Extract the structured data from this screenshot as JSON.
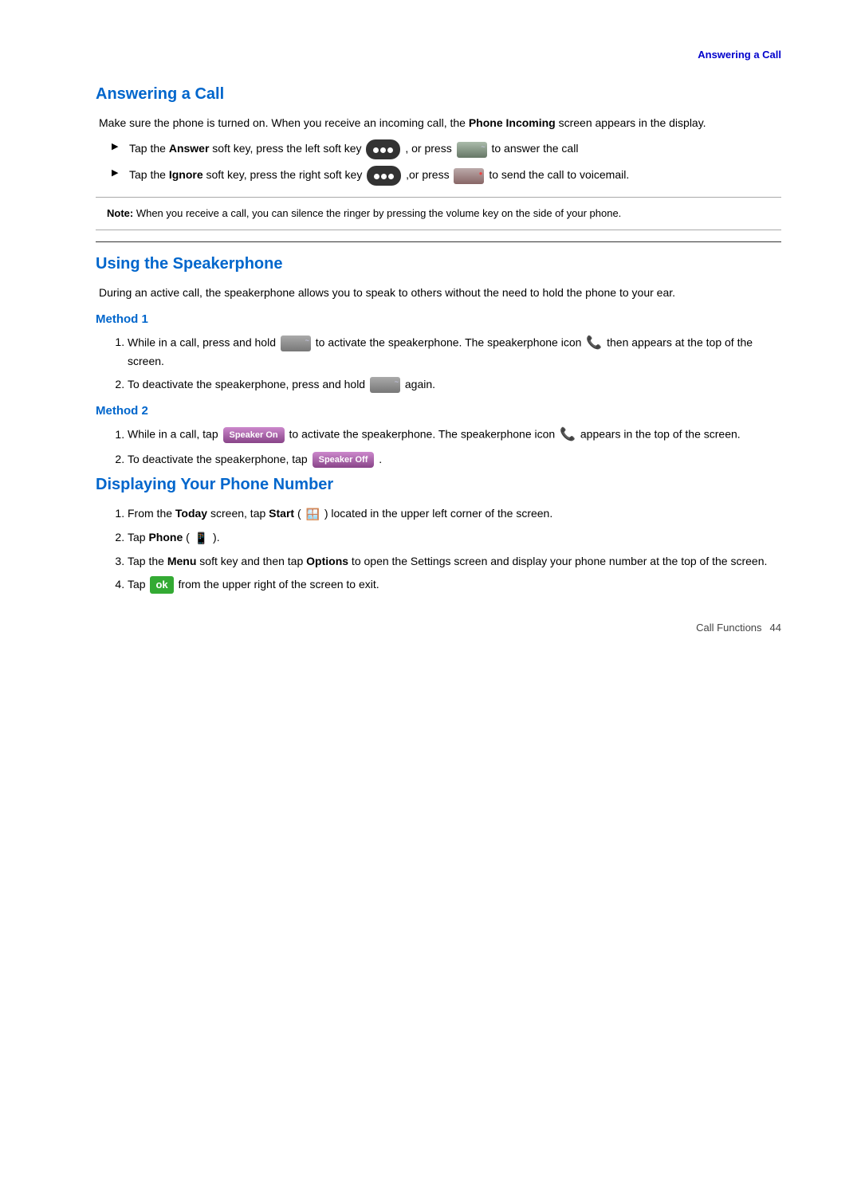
{
  "header": {
    "nav_label": "Answering a Call"
  },
  "section1": {
    "title": "Answering a Call",
    "intro": "Make sure the phone is turned on. When you receive an incoming call, the Phone Incoming screen appears in the display.",
    "bullets": [
      {
        "text_before": "Tap the ",
        "bold1": "Answer",
        "text_middle": " soft key, press the left soft key",
        "icon_oval": true,
        "text_after": ", or press",
        "key_type": "answer",
        "end_text": "to answer the call"
      },
      {
        "text_before": "Tap the ",
        "bold1": "Ignore",
        "text_middle": " soft key, press the right soft key",
        "icon_oval": true,
        "text_after": ",or press",
        "key_type": "ignore",
        "end_text": "to send the call to voicemail."
      }
    ],
    "note": "When you receive a call, you can silence the ringer by pressing the volume key on the side of your phone."
  },
  "section2": {
    "title": "Using the Speakerphone",
    "intro": "During an active call, the speakerphone allows you to speak to others without the need to hold the phone to your ear.",
    "method1": {
      "label": "Method 1",
      "steps": [
        "While in a call, press and hold [key] to activate the speakerphone. The speakerphone icon [icon] then appears at the top of the screen.",
        "To deactivate the speakerphone, press and hold [key] again."
      ]
    },
    "method2": {
      "label": "Method 2",
      "steps": [
        "While in a call, tap [SpeakerOn] to activate the speakerphone. The speakerphone icon [icon] appears in the top of the screen.",
        "To deactivate the speakerphone, tap [SpeakerOff] ."
      ]
    }
  },
  "section3": {
    "title": "Displaying Your Phone Number",
    "steps": [
      "From the Today screen, tap Start ([icon]) located in the upper left corner of the screen.",
      "Tap Phone ( [icon] ).",
      "Tap the Menu soft key and then tap Options to open the Settings screen and display your phone number at the top of the screen.",
      "Tap [ok] from the upper right of the screen to exit."
    ],
    "steps_data": [
      {
        "bold_word": "Today",
        "middle": " screen, tap ",
        "bold2": "Start",
        "rest": " located in the upper left corner of the screen."
      },
      {
        "bold_word": "Phone"
      },
      {
        "bold1": "Menu",
        "bold2": "Options",
        "text": "Tap the Menu soft key and then tap Options to open the Settings screen and display your phone number at the top of the screen."
      },
      {
        "text": "Tap",
        "bold_ok": "ok",
        "rest": "from the upper right of the screen to exit."
      }
    ]
  },
  "footer": {
    "left": "Call Functions",
    "right": "44"
  }
}
